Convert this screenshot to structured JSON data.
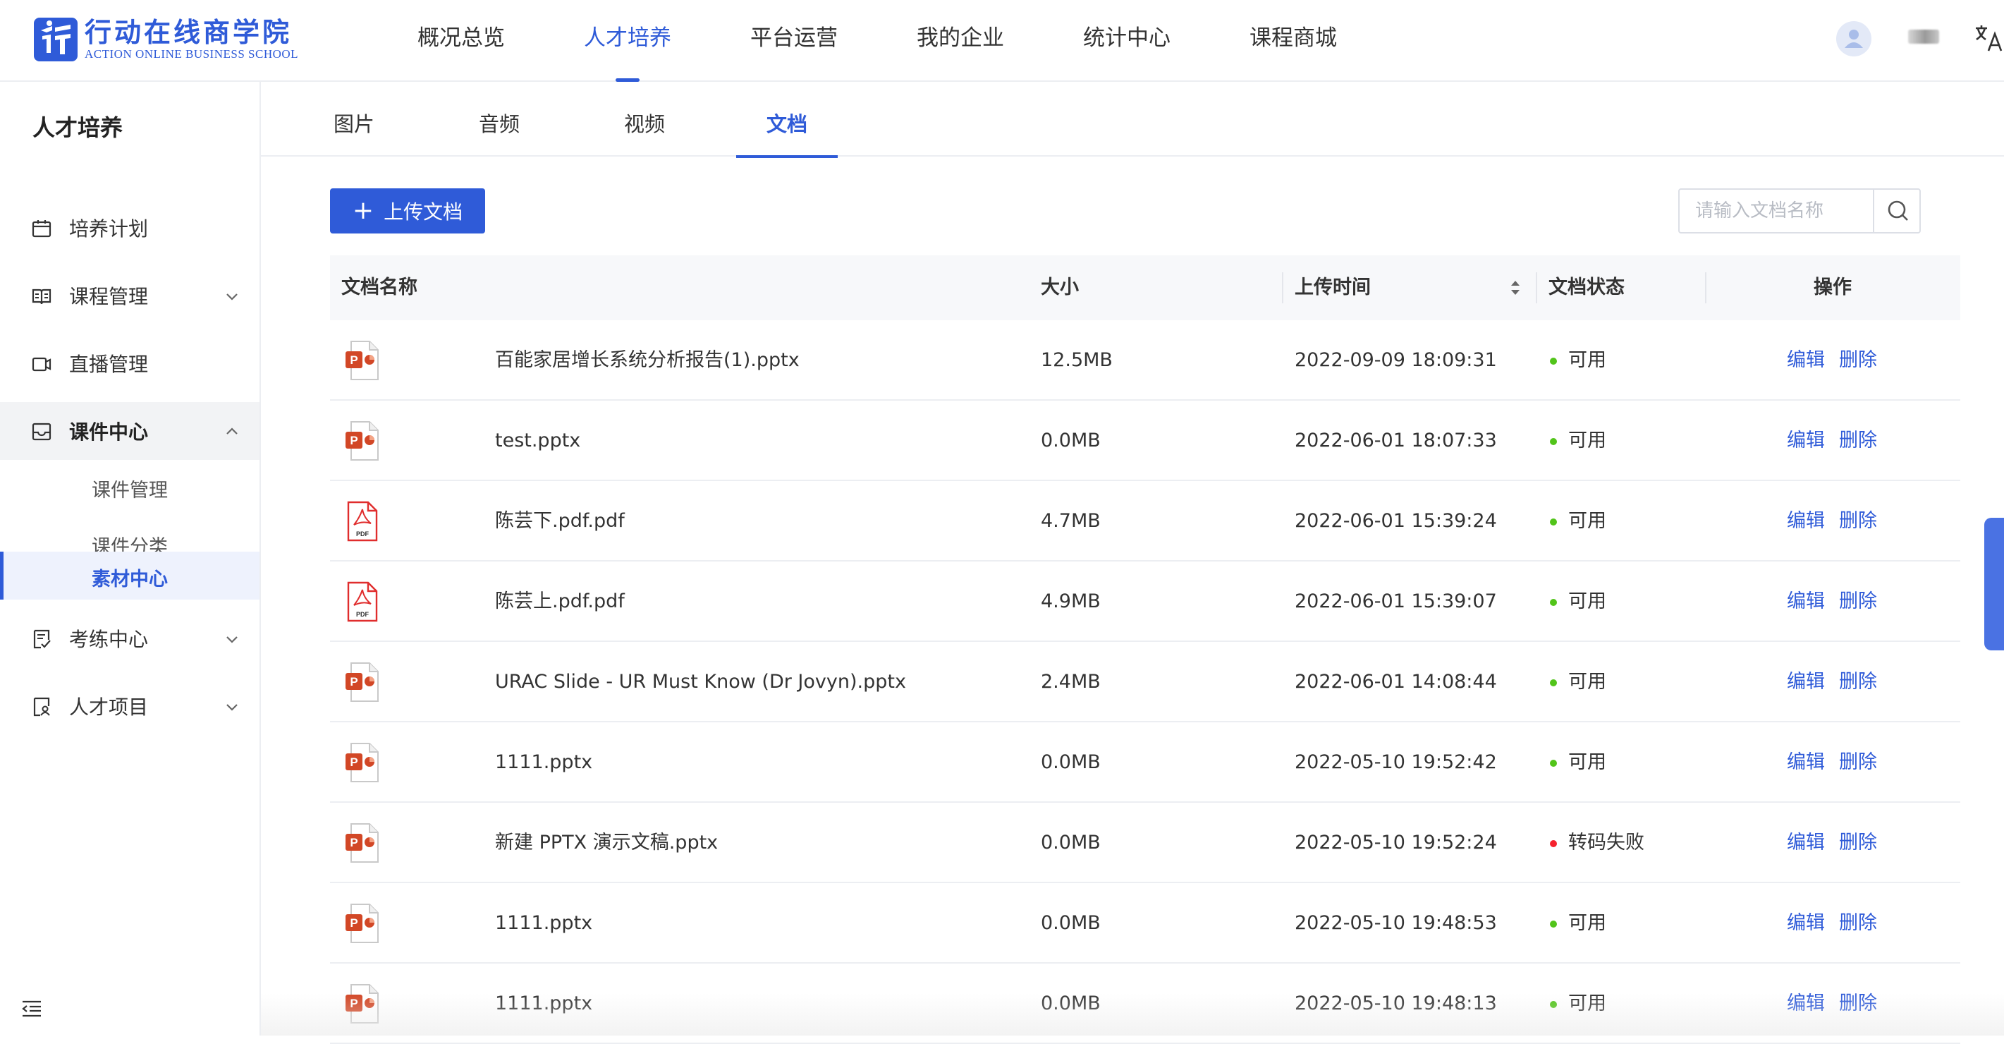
{
  "brand": {
    "name_cn": "行动在线商学院",
    "name_en": "ACTION ONLINE BUSINESS SCHOOL",
    "color": "#2f5bd8"
  },
  "topnav": {
    "items": [
      {
        "label": "概况总览",
        "active": false
      },
      {
        "label": "人才培养",
        "active": true
      },
      {
        "label": "平台运营",
        "active": false
      },
      {
        "label": "我的企业",
        "active": false
      },
      {
        "label": "统计中心",
        "active": false
      },
      {
        "label": "课程商城",
        "active": false
      }
    ]
  },
  "sidebar": {
    "title": "人才培养",
    "items": [
      {
        "label": "培养计划",
        "icon": "calendar-icon"
      },
      {
        "label": "课程管理",
        "icon": "book-icon",
        "expandable": true
      },
      {
        "label": "直播管理",
        "icon": "video-camera-icon"
      },
      {
        "label": "课件中心",
        "icon": "inbox-icon",
        "expandable": true,
        "open": true
      },
      {
        "label": "考练中心",
        "icon": "exam-icon",
        "expandable": true
      },
      {
        "label": "人才项目",
        "icon": "person-doc-icon",
        "expandable": true
      }
    ],
    "sub_items": [
      {
        "label": "课件管理",
        "active": false
      },
      {
        "label": "课件分类",
        "active": false
      },
      {
        "label": "素材中心",
        "active": true
      }
    ]
  },
  "tabs": [
    {
      "label": "图片",
      "active": false
    },
    {
      "label": "音频",
      "active": false
    },
    {
      "label": "视频",
      "active": false
    },
    {
      "label": "文档",
      "active": true
    }
  ],
  "toolbar": {
    "upload_label": "上传文档",
    "search_placeholder": "请输入文档名称"
  },
  "table": {
    "columns": [
      "文档名称",
      "大小",
      "上传时间",
      "文档状态",
      "操作"
    ],
    "edit_label": "编辑",
    "delete_label": "删除",
    "rows": [
      {
        "type": "pptx",
        "name": "百能家居增长系统分析报告(1).pptx",
        "size": "12.5MB",
        "time": "2022-09-09 18:09:31",
        "status": "可用",
        "ok": true
      },
      {
        "type": "pptx",
        "name": "test.pptx",
        "size": "0.0MB",
        "time": "2022-06-01 18:07:33",
        "status": "可用",
        "ok": true
      },
      {
        "type": "pdf",
        "name": "陈芸下.pdf.pdf",
        "size": "4.7MB",
        "time": "2022-06-01 15:39:24",
        "status": "可用",
        "ok": true
      },
      {
        "type": "pdf",
        "name": "陈芸上.pdf.pdf",
        "size": "4.9MB",
        "time": "2022-06-01 15:39:07",
        "status": "可用",
        "ok": true
      },
      {
        "type": "pptx",
        "name": "URAC Slide - UR Must Know (Dr Jovyn).pptx",
        "size": "2.4MB",
        "time": "2022-06-01 14:08:44",
        "status": "可用",
        "ok": true
      },
      {
        "type": "pptx",
        "name": "1111.pptx",
        "size": "0.0MB",
        "time": "2022-05-10 19:52:42",
        "status": "可用",
        "ok": true
      },
      {
        "type": "pptx",
        "name": "新建 PPTX 演示文稿.pptx",
        "size": "0.0MB",
        "time": "2022-05-10 19:52:24",
        "status": "转码失败",
        "ok": false
      },
      {
        "type": "pptx",
        "name": "1111.pptx",
        "size": "0.0MB",
        "time": "2022-05-10 19:48:53",
        "status": "可用",
        "ok": true
      },
      {
        "type": "pptx",
        "name": "1111.pptx",
        "size": "0.0MB",
        "time": "2022-05-10 19:48:13",
        "status": "可用",
        "ok": true
      }
    ]
  },
  "colors": {
    "status_ok": "#52c41a",
    "status_fail": "#f5222d",
    "ppt": "#d24726",
    "pdf": "#e02d2d"
  }
}
